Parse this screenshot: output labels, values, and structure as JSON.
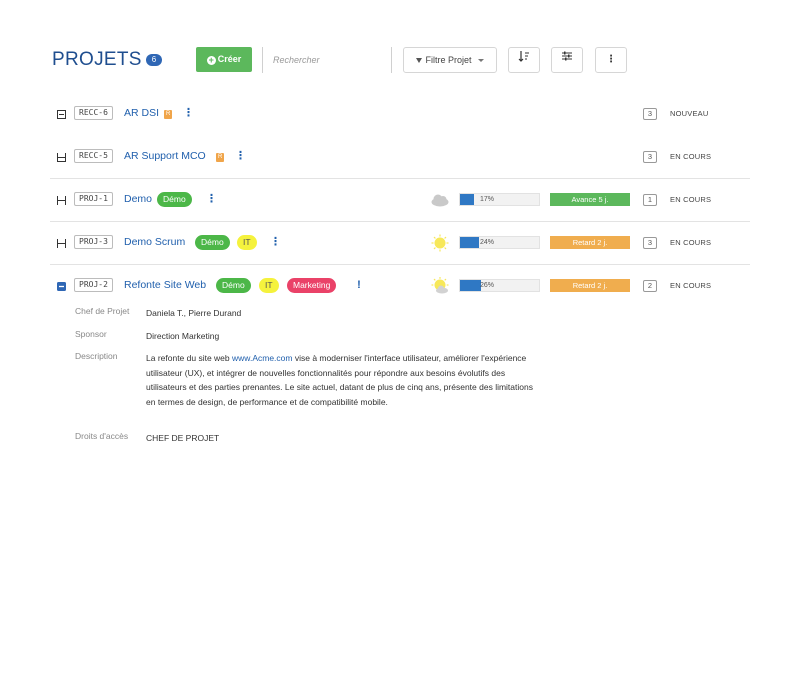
{
  "header": {
    "title": "PROJETS",
    "count": "6",
    "create_label": "Créer",
    "search_placeholder": "Rechercher",
    "filter_label": "Filtre Projet",
    "sort_icon": "sort-icon",
    "settings_icon": "sliders-icon",
    "more_icon": "kebab-icon"
  },
  "projects": [
    {
      "code": "RECC-6",
      "name": "AR DSI",
      "tags": [
        {
          "label": "R",
          "color": "#f0a54a"
        }
      ],
      "count": "3",
      "status": "NOUVEAU"
    },
    {
      "code": "RECC-5",
      "name": "AR Support MCO",
      "tags": [
        {
          "label": "R",
          "color": "#f0a54a"
        }
      ],
      "count": "3",
      "status": "EN COURS"
    },
    {
      "code": "PROJ-1",
      "name": "Demo",
      "tags": [
        {
          "label": "Démo",
          "color": "#4cb748"
        }
      ],
      "weather": "cloudy",
      "progress": "17%",
      "progress_value": 0.17,
      "delay": "Avance 5 j.",
      "delay_color": "#5cb85c",
      "count": "1",
      "status": "EN COURS"
    },
    {
      "code": "PROJ-3",
      "name": "Demo Scrum",
      "tags": [
        {
          "label": "Démo",
          "color": "#4cb748"
        },
        {
          "label": "IT",
          "color": "#f5f23d"
        }
      ],
      "weather": "sunny",
      "progress": "24%",
      "progress_value": 0.24,
      "delay": "Retard 2 j.",
      "delay_color": "#f0ad4e",
      "count": "3",
      "status": "EN COURS"
    },
    {
      "code": "PROJ-2",
      "name": "Refonte Site Web",
      "tags": [
        {
          "label": "Démo",
          "color": "#4cb748"
        },
        {
          "label": "IT",
          "color": "#f5f23d"
        },
        {
          "label": "Marketing",
          "color": "#ea4268"
        }
      ],
      "weather": "partly-sunny",
      "progress": "26%",
      "progress_value": 0.26,
      "delay": "Retard 2 j.",
      "delay_color": "#f0ad4e",
      "count": "2",
      "status": "EN COURS",
      "alert": "!"
    }
  ],
  "details": {
    "manager_label": "Chef de Projet",
    "manager_value": "Daniela T., Pierre Durand",
    "sponsor_label": "Sponsor",
    "sponsor_value": "Direction Marketing",
    "description_label": "Description",
    "description_before": "La refonte du site web ",
    "description_link": "www.Acme.com",
    "description_after": " vise à moderniser l'interface utilisateur, améliorer l'expérience utilisateur (UX), et intégrer de nouvelles fonctionnalités pour répondre aux besoins évolutifs des utilisateurs et des parties prenantes. Le site actuel, datant de plus de cinq ans, présente des limitations en termes de design, de performance et de compatibilité mobile.",
    "access_label": "Droits d'accès",
    "access_value": "CHEF DE PROJET"
  }
}
